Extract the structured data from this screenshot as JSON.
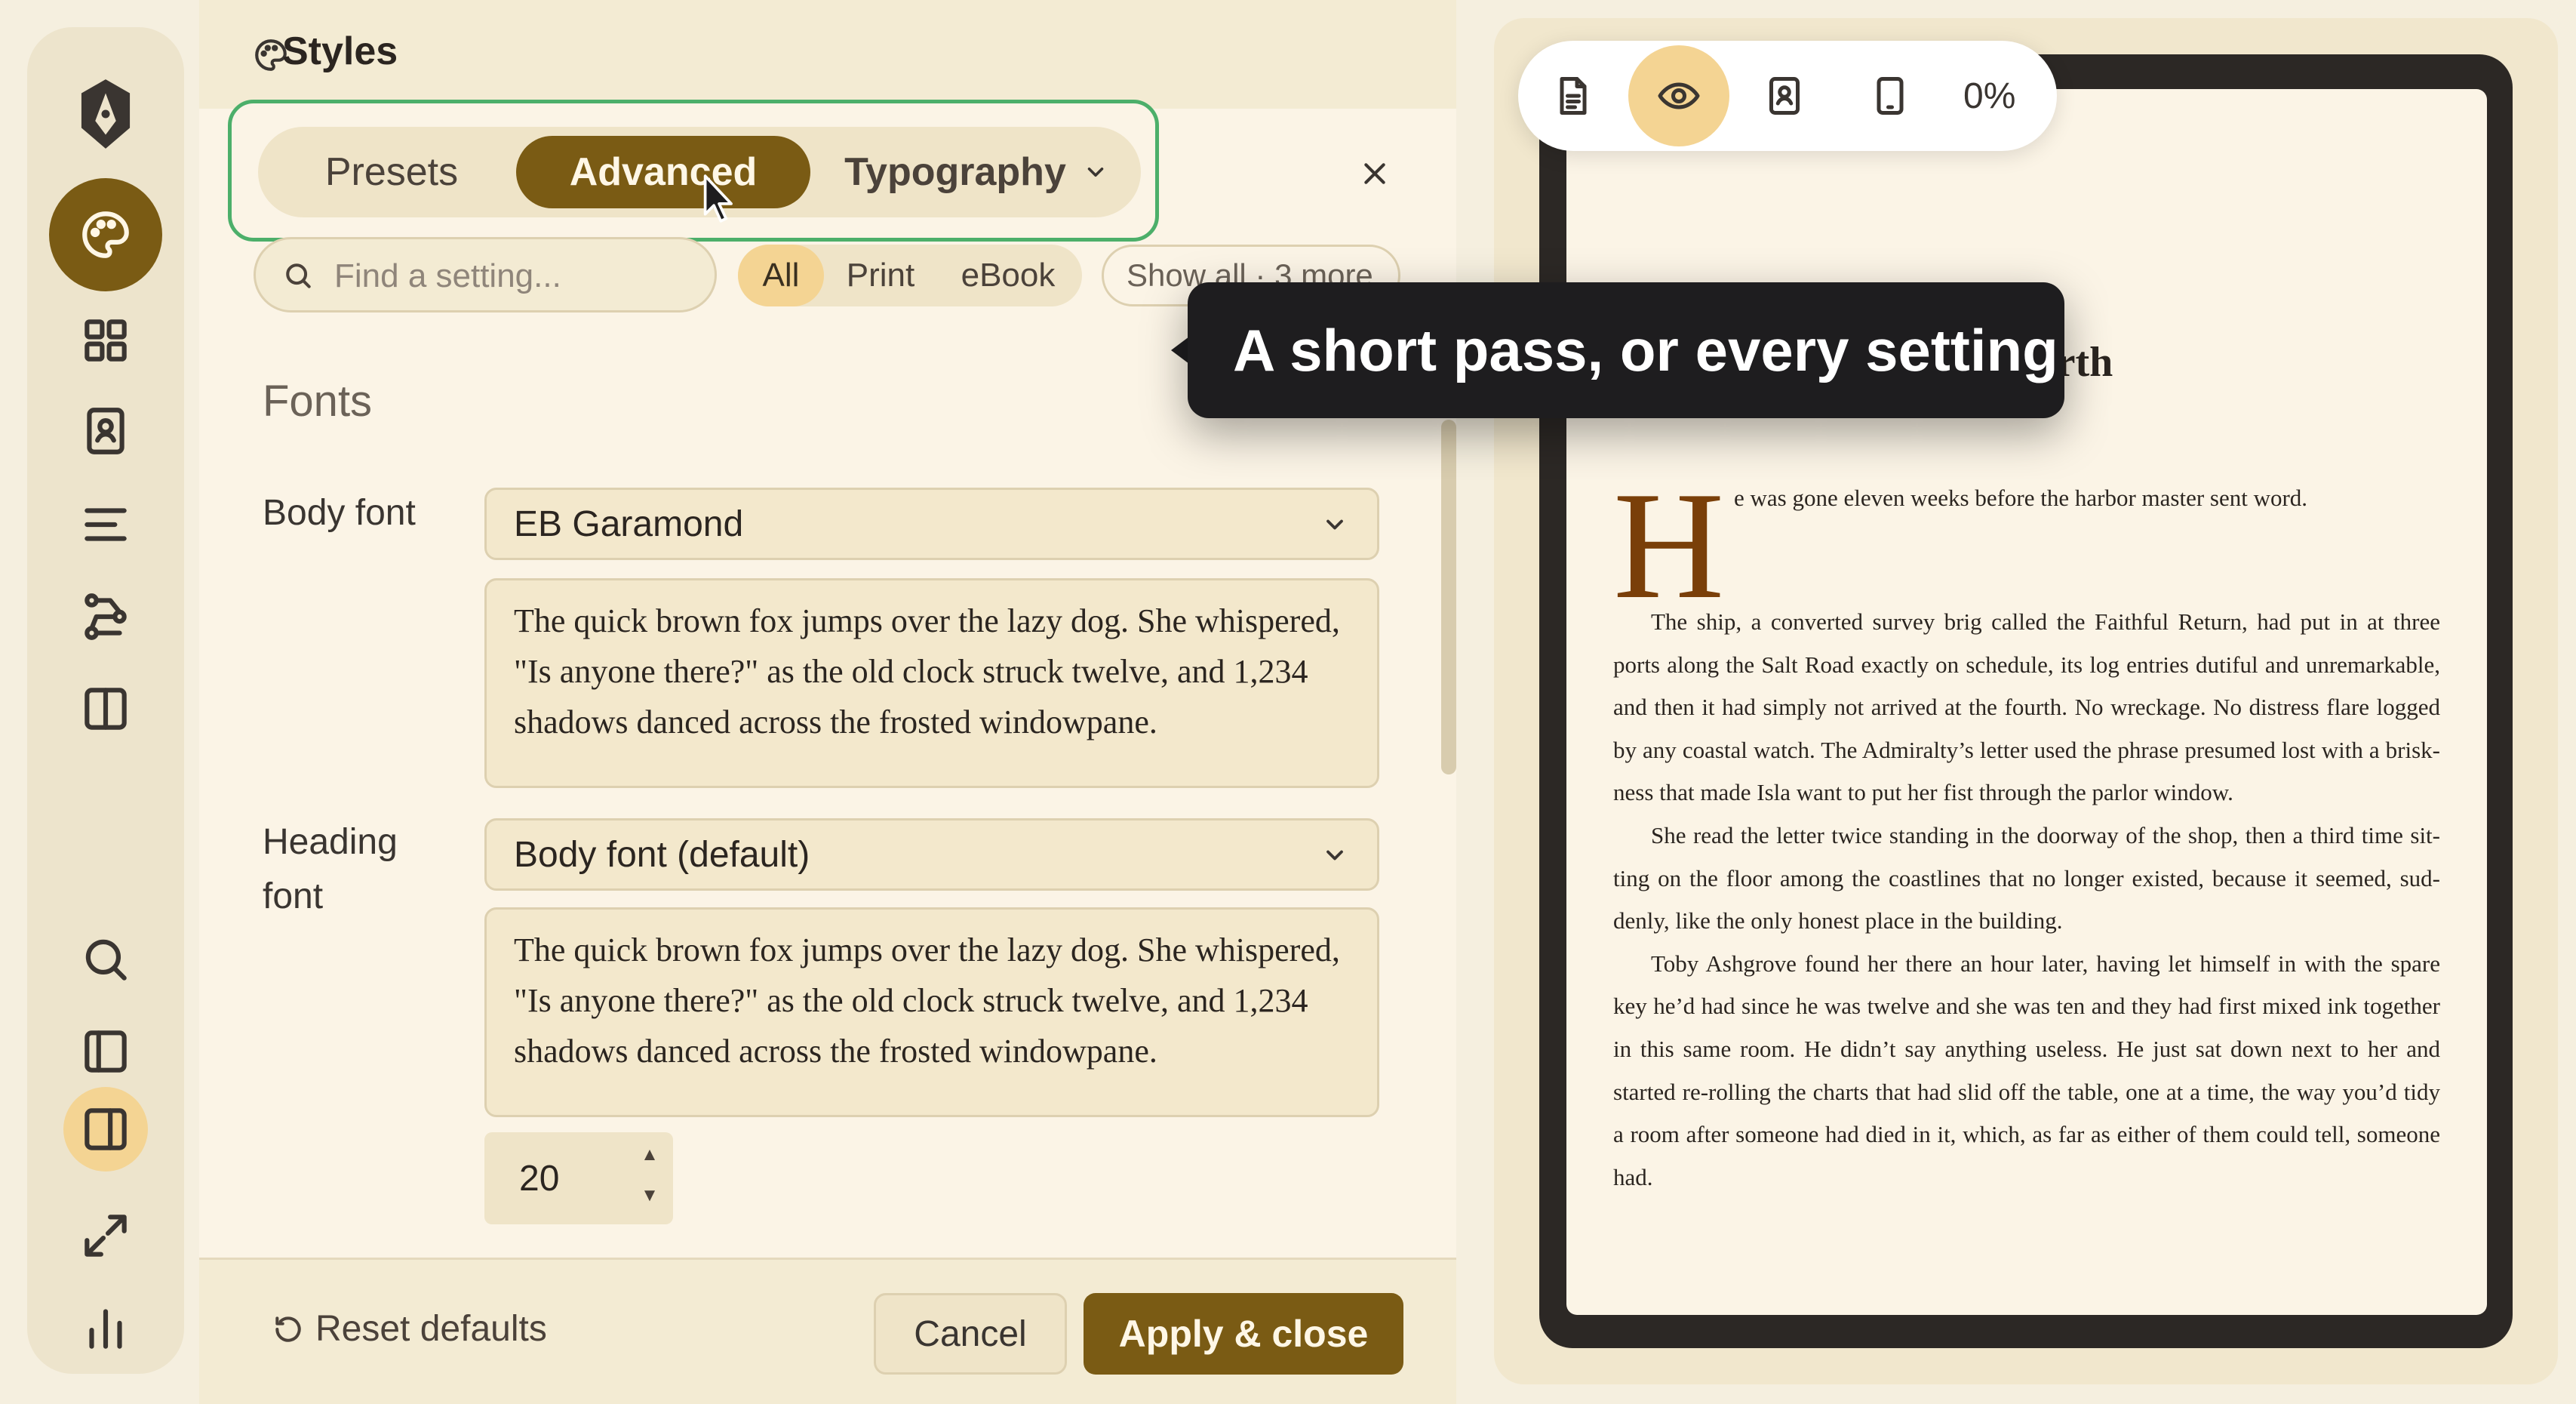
{
  "panel": {
    "title": "Styles",
    "tabs": [
      {
        "label": "Presets",
        "active": false
      },
      {
        "label": "Advanced",
        "active": true
      },
      {
        "label": "Typography",
        "active": false
      }
    ],
    "search_placeholder": "Find a setting...",
    "filters": [
      {
        "label": "All",
        "active": true
      },
      {
        "label": "Print",
        "active": false
      },
      {
        "label": "eBook",
        "active": false
      }
    ],
    "show_all_label": "Show all · 3 more",
    "section_heading": "Fonts",
    "body_font": {
      "label": "Body font",
      "value": "EB Garamond",
      "preview": "The quick brown fox jumps over the lazy dog. She whispered, \"Is anyone there?\" as the old clock struck twelve, and 1,234 shadows danced across the frosted windowpane."
    },
    "heading_font": {
      "label": "Heading font",
      "value": "Body font (default)",
      "preview": "The quick brown fox jumps over the lazy dog. She whispered, \"Is anyone there?\" as the old clock struck twelve, and 1,234 shadows danced across the frosted windowpane."
    },
    "size_value": "20",
    "footer": {
      "reset_label": "Reset defaults",
      "cancel_label": "Cancel",
      "apply_label": "Apply & close"
    }
  },
  "tooltip": "A short pass, or every setting",
  "toolbar": {
    "percent": "0%",
    "active_view": "eye-icon"
  },
  "book": {
    "title_visible": "pty Berth",
    "drop_cap": "H",
    "first_line": "e was gone eleven weeks before the harbor master sent word.",
    "paragraphs": [
      "The ship, a converted survey brig called the Faithful Return, had put in at three ports along the Salt Road exactly on schedule, its log entries dutiful and unremarkable, and then it had simply not arrived at the fourth. No wreckage. No distress flare logged by any coastal watch. The Admiralty’s letter used the phrase presumed lost with a brisk-ness that made Isla want to put her fist through the parlor window.",
      "She read the letter twice standing in the doorway of the shop, then a third time sit-ting on the floor among the coastlines that no longer existed, because it seemed, sud-denly, like the only honest place in the building.",
      "Toby Ashgrove found her there an hour later, having let himself in with the spare key he’d had since he was twelve and she was ten and they had first mixed ink together in this same room. He didn’t say anything useless. He just sat down next to her and started re-rolling the charts that had slid off the table, one at a time, the way you’d tidy a room after someone had died in it, which, as far as either of them could tell, someone had."
    ]
  },
  "colors": {
    "accent": "#7a5b14",
    "accent_soft": "#f4d493",
    "focus_ring": "#4caf6a",
    "drop_cap": "#7a3f09",
    "tooltip_bg": "#1e1d1f"
  }
}
